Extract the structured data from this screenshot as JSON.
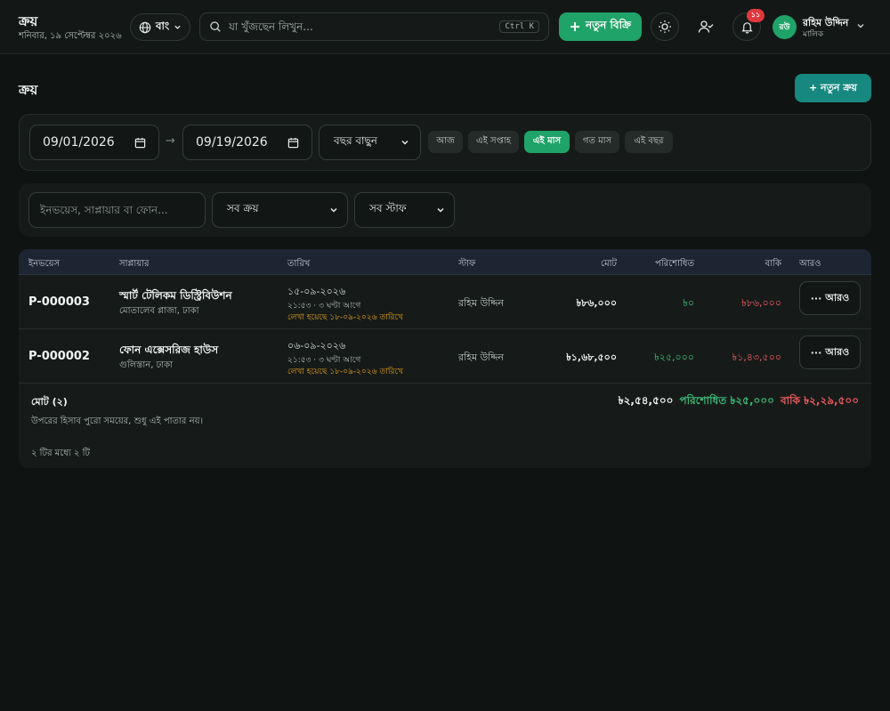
{
  "app": {
    "title": "ক্রয়",
    "date": "শনিবার, ১৯ সেপ্টেম্বর ২০২৬"
  },
  "topbar": {
    "language": "বাং",
    "search_placeholder": "যা খুঁজছেন লিখুন...",
    "search_shortcut": "Ctrl K",
    "new_sale": "নতুন বিক্রি",
    "notification_count": "১১",
    "user_initials": "রউ",
    "user_name": "রহিম উদ্দিন",
    "user_role": "মালিক"
  },
  "page": {
    "title": "ক্রয়",
    "new_purchase": "+ নতুন ক্রয়"
  },
  "date_filter": {
    "from": "09/01/2026",
    "to": "09/19/2026",
    "arrow": "→",
    "year_select": "বছর বাছুন",
    "chips": [
      {
        "label": "আজ",
        "active": false
      },
      {
        "label": "এই সপ্তাহ",
        "active": false
      },
      {
        "label": "এই মাস",
        "active": true
      },
      {
        "label": "গত মাস",
        "active": false
      },
      {
        "label": "এই বছর",
        "active": false
      }
    ]
  },
  "filters": {
    "search_placeholder": "ইনভয়েস, সাপ্লায়ার বা ফোন...",
    "purchase_select": "সব ক্রয়",
    "staff_select": "সব স্টাফ"
  },
  "table": {
    "headers": {
      "invoice": "ইনভয়েস",
      "supplier": "সাপ্লায়ার",
      "date": "তারিখ",
      "staff": "স্টাফ",
      "total": "মোট",
      "paid": "পরিশোধিত",
      "due": "বাকি",
      "more": "আরও"
    },
    "rows": [
      {
        "invoice": "P-000003",
        "supplier": "স্মার্ট টেলিকম ডিস্ট্রিবিউশন",
        "address": "মোতালেব প্লাজা, ঢাকা",
        "date": "১৫-০৯-২০২৬",
        "ago": "২১:৫৩ · ৩ ঘণ্টা আগে",
        "written": "লেখা হয়েছে ১৮-০৯-২০২৬ তারিখে",
        "staff": "রহিম উদ্দিন",
        "total": "৳৮৬,০০০",
        "paid": "৳০",
        "due": "৳৮৬,০০০",
        "more": "আরও"
      },
      {
        "invoice": "P-000002",
        "supplier": "ফোন এক্সেসরিজ হাউস",
        "address": "গুলিস্তান, ঢাকা",
        "date": "০৬-০৯-২০২৬",
        "ago": "২১:৫৩ · ৩ ঘণ্টা আগে",
        "written": "লেখা হয়েছে ১৮-০৯-২০২৬ তারিখে",
        "staff": "রহিম উদ্দিন",
        "total": "৳১,৬৮,৫০০",
        "paid": "৳২৫,০০০",
        "due": "৳১,৪৩,৫০০",
        "more": "আরও"
      }
    ],
    "footer": {
      "label": "মোট (২)",
      "note": "উপরের হিসাব পুরো সময়ের, শুধু এই পাতার নয়।",
      "total": "৳২,৫৪,৫০০",
      "paid": "পরিশোধিত ৳২৫,০০০",
      "due": "বাকি ৳২,২৯,৫০০",
      "pagination": "২ টির মধ্যে ২ টি"
    }
  },
  "colors": {
    "accent": "#1fa368",
    "teal": "#16887f",
    "paid": "#3dbb78",
    "due": "#ef5a5f",
    "warning": "#f0a21a"
  }
}
